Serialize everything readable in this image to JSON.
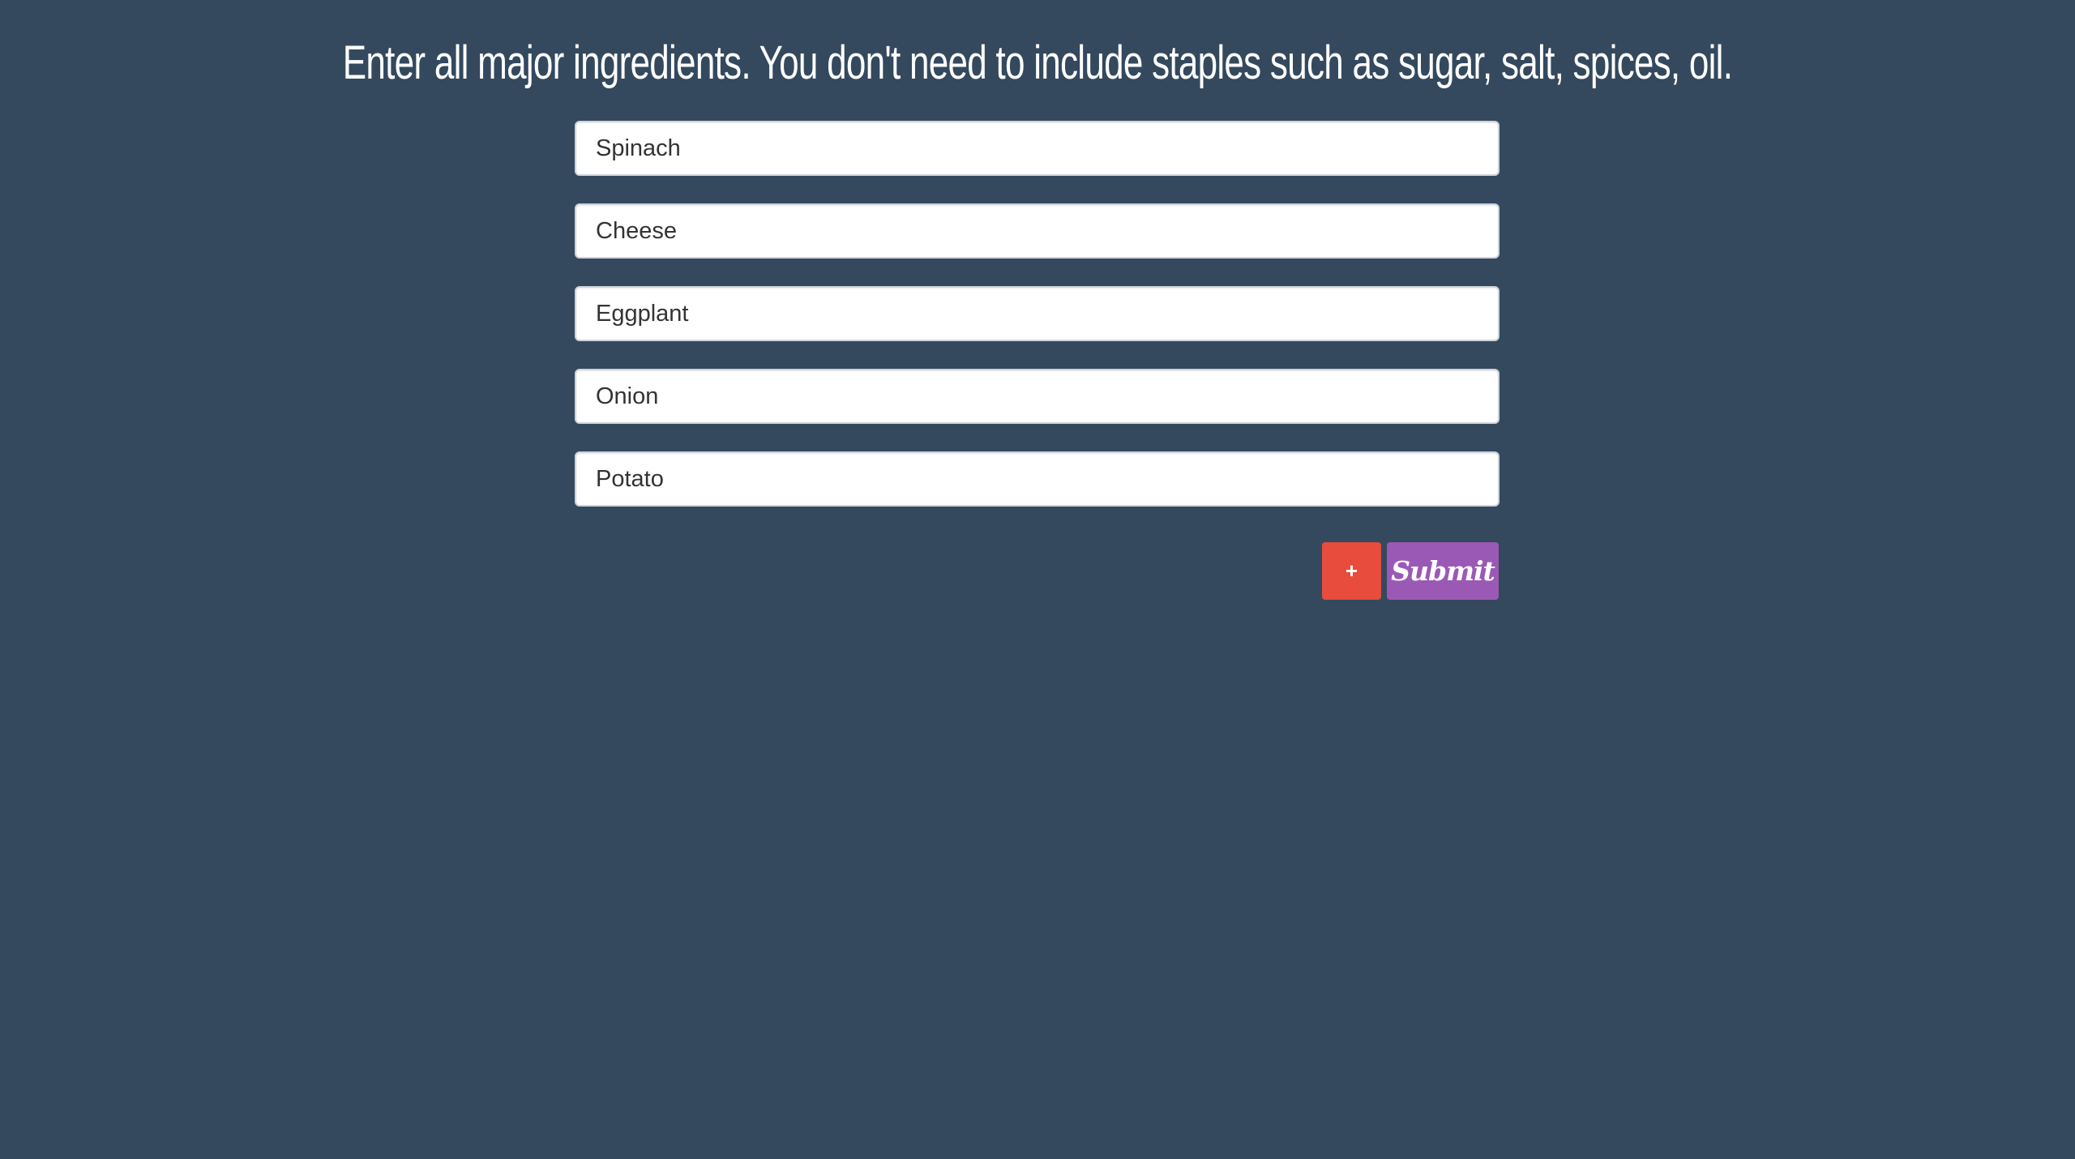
{
  "page": {
    "instructions": "Enter all major ingredients. You don't need to include staples such as sugar, salt, spices, oil."
  },
  "ingredients": [
    {
      "value": "Spinach"
    },
    {
      "value": "Cheese"
    },
    {
      "value": "Eggplant"
    },
    {
      "value": "Onion"
    },
    {
      "value": "Potato"
    }
  ],
  "buttons": {
    "add_label": "+",
    "submit_label": "Submit"
  },
  "colors": {
    "background": "#34495e",
    "add_button": "#e74c3c",
    "submit_button": "#9b59b6",
    "input_background": "#ffffff"
  }
}
